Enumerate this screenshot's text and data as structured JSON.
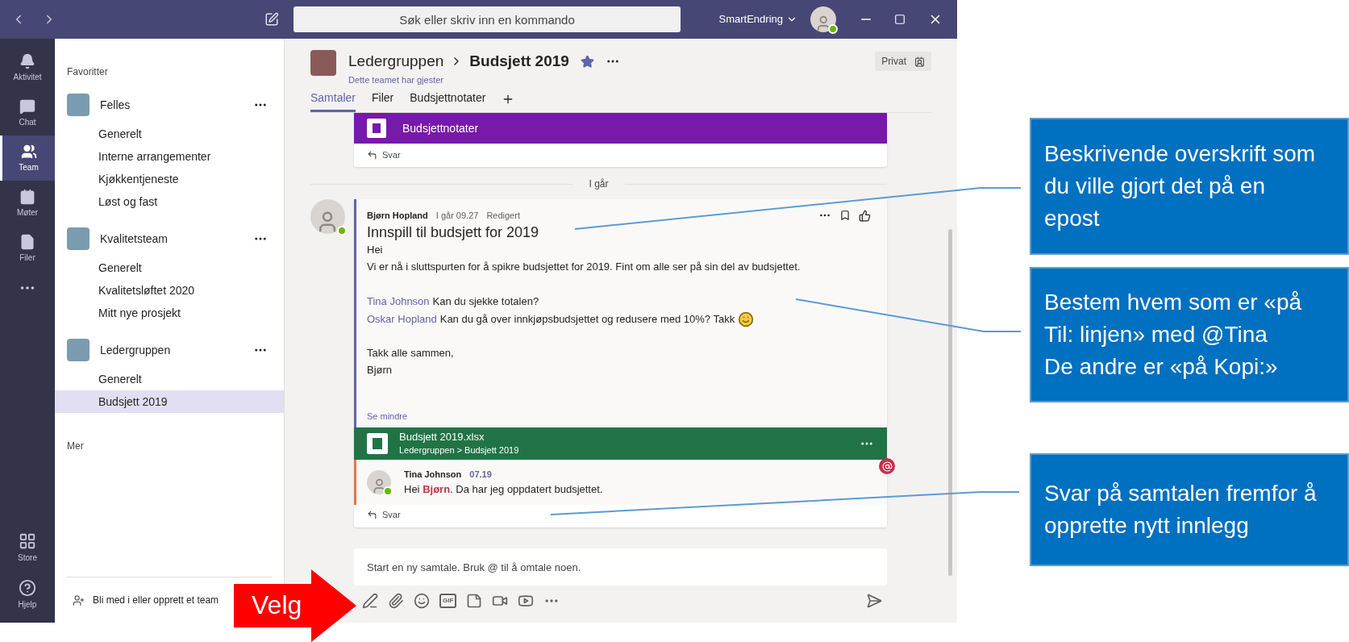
{
  "titlebar": {
    "search_placeholder": "Søk eller skriv inn en kommando",
    "account": "SmartEndring",
    "user_online": true
  },
  "rail": {
    "items": [
      {
        "label": "Aktivitet",
        "kind": "activity",
        "selected": false
      },
      {
        "label": "Chat",
        "kind": "chat",
        "selected": false
      },
      {
        "label": "Team",
        "kind": "teams",
        "selected": true
      },
      {
        "label": "Møter",
        "kind": "calendar",
        "selected": false
      },
      {
        "label": "Filer",
        "kind": "files",
        "selected": false
      }
    ],
    "bottom": [
      {
        "label": "Store",
        "kind": "store"
      },
      {
        "label": "Hjelp",
        "kind": "help"
      }
    ]
  },
  "sidebar": {
    "heading": "Favoritter",
    "teams": [
      {
        "name": "Felles",
        "channels": [
          {
            "label": "Generelt",
            "selected": false
          },
          {
            "label": "Interne arrangementer",
            "selected": false
          },
          {
            "label": "Kjøkkentjeneste",
            "selected": false
          },
          {
            "label": "Løst og fast",
            "selected": false
          }
        ]
      },
      {
        "name": "Kvalitetsteam",
        "channels": [
          {
            "label": "Generelt",
            "selected": false
          },
          {
            "label": "Kvalitetsløftet 2020",
            "selected": false
          },
          {
            "label": "Mitt nye prosjekt",
            "selected": false
          }
        ]
      },
      {
        "name": "Ledergruppen",
        "channels": [
          {
            "label": "Generelt",
            "selected": false
          },
          {
            "label": "Budsjett 2019",
            "selected": true
          }
        ]
      }
    ],
    "more_heading": "Mer",
    "join": "Bli med i eller opprett et team"
  },
  "channel": {
    "team": "Ledergruppen",
    "name": "Budsjett 2019",
    "favorite": true,
    "subtitle": "Dette teamet har gjester",
    "privacy": "Privat",
    "tabs": [
      {
        "label": "Samtaler",
        "selected": true
      },
      {
        "label": "Filer",
        "selected": false
      },
      {
        "label": "Budsjettnotater",
        "selected": false
      }
    ]
  },
  "feed": {
    "card": {
      "title": "Budsjettnotater",
      "reply": "Svar"
    },
    "divider": "I går",
    "post": {
      "author": "Bjørn Hopland",
      "time": "I går 09.27",
      "edited": "Redigert",
      "online": true,
      "subject": "Innspill til budsjett for 2019",
      "paragraphs": [
        {
          "lines": [
            {
              "text": "Hei"
            },
            {
              "text": "Vi er nå i sluttspurten for å spikre budsjettet for 2019. Fint om alle ser på sin del av budsjettet."
            }
          ]
        },
        {
          "lines": [
            {
              "mention": "Tina Johnson",
              "text": "Kan du sjekke totalen?",
              "emoji": false
            },
            {
              "mention": "Oskar Hopland",
              "text": "Kan du gå over innkjøpsbudsjettet og redusere med 10%? Takk",
              "emoji": true
            }
          ]
        },
        {
          "lines": [
            {
              "text": "Takk alle sammen,"
            },
            {
              "text": "Bjørn"
            }
          ]
        }
      ],
      "collapse": "Se mindre",
      "attachment": {
        "name": "Budsjett 2019.xlsx",
        "path": "Ledergruppen > Budsjett 2019"
      },
      "replies": [
        {
          "author": "Tina Johnson",
          "time": "07.19",
          "online": true,
          "mentioned": true,
          "text": "Hei **Bjørn**. Da har jeg oppdatert budsjettet."
        }
      ],
      "reply": "Svar"
    }
  },
  "compose": {
    "placeholder": "Start en ny samtale. Bruk @ til å omtale noen.",
    "tools": [
      {
        "kind": "format"
      },
      {
        "kind": "attach"
      },
      {
        "kind": "emoji"
      },
      {
        "kind": "gif",
        "label": "GIF"
      },
      {
        "kind": "sticker"
      },
      {
        "kind": "meet"
      },
      {
        "kind": "video"
      },
      {
        "kind": "more"
      }
    ]
  },
  "callouts": [
    {
      "lines": [
        "Beskrivende overskrift som du ville gjort det på en epost"
      ]
    },
    {
      "lines": [
        "Bestem hvem som er «på Til: linjen» med @Tina",
        "De andre er «på Kopi:»"
      ]
    },
    {
      "lines": [
        "Svar på samtalen fremfor å opprette nytt innlegg"
      ]
    }
  ],
  "arrow_label": "Velg"
}
